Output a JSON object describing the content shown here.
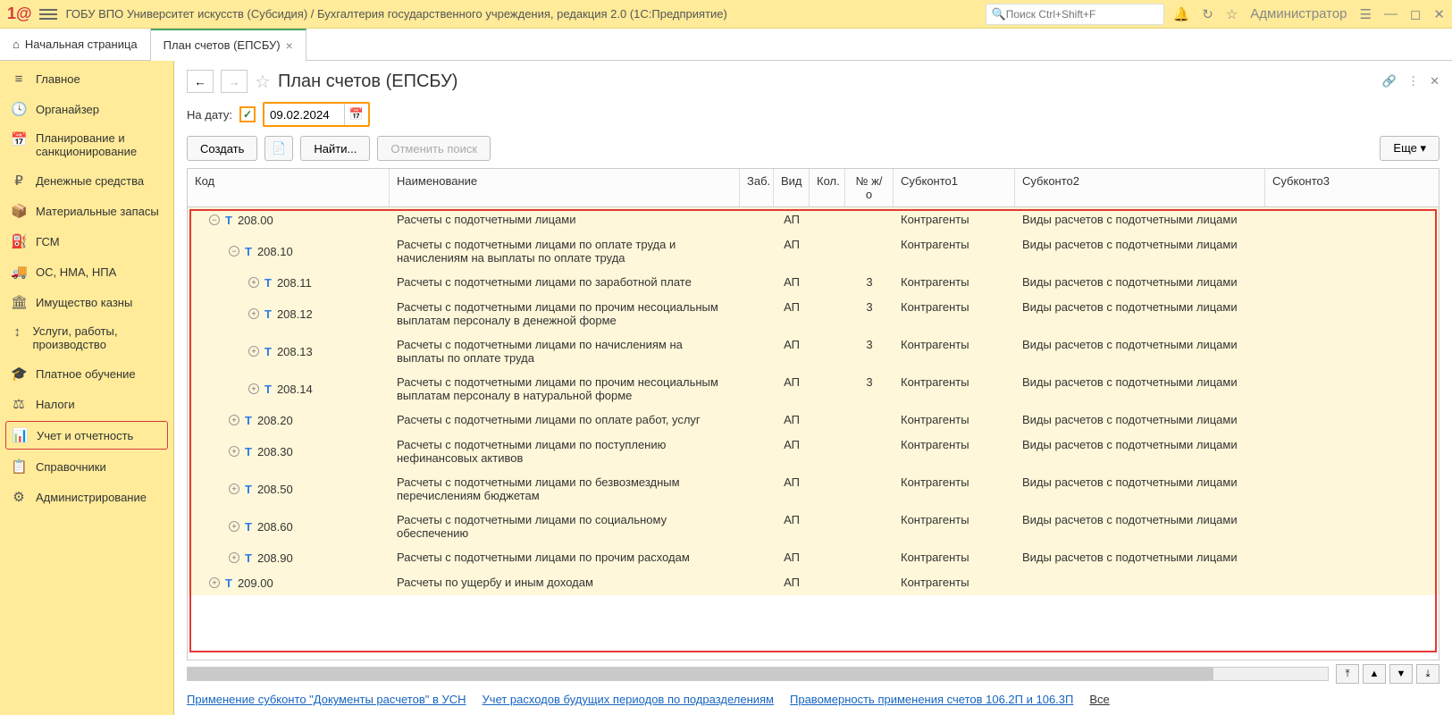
{
  "header": {
    "logo": "1@",
    "title": "ГОБУ ВПО Университет искусств (Субсидия) / Бухгалтерия государственного учреждения, редакция 2.0  (1С:Предприятие)",
    "search_placeholder": "Поиск Ctrl+Shift+F",
    "user": "Администратор"
  },
  "tabs": [
    {
      "label": "Начальная страница",
      "icon": "⌂"
    },
    {
      "label": "План счетов (ЕПСБУ)",
      "closable": true
    }
  ],
  "sidebar": [
    {
      "icon": "≡",
      "label": "Главное"
    },
    {
      "icon": "🕓",
      "label": "Органайзер"
    },
    {
      "icon": "📅",
      "label": "Планирование и санкционирование"
    },
    {
      "icon": "₽",
      "label": "Денежные средства"
    },
    {
      "icon": "📦",
      "label": "Материальные запасы"
    },
    {
      "icon": "⛽",
      "label": "ГСМ"
    },
    {
      "icon": "🚚",
      "label": "ОС, НМА, НПА"
    },
    {
      "icon": "🏛",
      "label": "Имущество казны"
    },
    {
      "icon": "↕",
      "label": "Услуги, работы, производство"
    },
    {
      "icon": "🎓",
      "label": "Платное обучение"
    },
    {
      "icon": "⚖",
      "label": "Налоги"
    },
    {
      "icon": "📊",
      "label": "Учет и отчетность",
      "selected": true
    },
    {
      "icon": "📋",
      "label": "Справочники"
    },
    {
      "icon": "⚙",
      "label": "Администрирование"
    }
  ],
  "page": {
    "title": "План счетов (ЕПСБУ)",
    "date_label": "На дату:",
    "date_value": "09.02.2024",
    "btn_create": "Создать",
    "btn_find": "Найти...",
    "btn_cancel": "Отменить поиск",
    "btn_more": "Еще ▾",
    "checkmark": "✓"
  },
  "grid": {
    "cols": {
      "code": "Код",
      "name": "Наименование",
      "zab": "Заб.",
      "vid": "Вид",
      "kol": "Кол.",
      "jo": "№ ж/о",
      "sub1": "Субконто1",
      "sub2": "Субконто2",
      "sub3": "Субконто3"
    },
    "rows": [
      {
        "lvl": 1,
        "exp": "−",
        "code": "208.00",
        "name": "Расчеты с подотчетными лицами",
        "vid": "АП",
        "jo": "",
        "sub1": "Контрагенты",
        "sub2": "Виды расчетов с подотчетными лицами"
      },
      {
        "lvl": 2,
        "exp": "−",
        "code": "208.10",
        "name": "Расчеты с подотчетными лицами по оплате труда и начислениям на выплаты по оплате труда",
        "vid": "АП",
        "jo": "",
        "sub1": "Контрагенты",
        "sub2": "Виды расчетов с подотчетными лицами"
      },
      {
        "lvl": 3,
        "exp": "+",
        "code": "208.11",
        "name": "Расчеты с подотчетными лицами по заработной плате",
        "vid": "АП",
        "jo": "3",
        "sub1": "Контрагенты",
        "sub2": "Виды расчетов с подотчетными лицами"
      },
      {
        "lvl": 3,
        "exp": "+",
        "code": "208.12",
        "name": "Расчеты с подотчетными лицами по прочим несоциальным выплатам персоналу в денежной форме",
        "vid": "АП",
        "jo": "3",
        "sub1": "Контрагенты",
        "sub2": "Виды расчетов с подотчетными лицами"
      },
      {
        "lvl": 3,
        "exp": "+",
        "code": "208.13",
        "name": "Расчеты с подотчетными лицами по начислениям на выплаты по оплате труда",
        "vid": "АП",
        "jo": "3",
        "sub1": "Контрагенты",
        "sub2": "Виды расчетов с подотчетными лицами"
      },
      {
        "lvl": 3,
        "exp": "+",
        "code": "208.14",
        "name": "Расчеты с подотчетными лицами по прочим несоциальным выплатам персоналу в натуральной форме",
        "vid": "АП",
        "jo": "3",
        "sub1": "Контрагенты",
        "sub2": "Виды расчетов с подотчетными лицами"
      },
      {
        "lvl": 2,
        "exp": "+",
        "code": "208.20",
        "name": "Расчеты с подотчетными лицами по оплате работ, услуг",
        "vid": "АП",
        "jo": "",
        "sub1": "Контрагенты",
        "sub2": "Виды расчетов с подотчетными лицами"
      },
      {
        "lvl": 2,
        "exp": "+",
        "code": "208.30",
        "name": "Расчеты с подотчетными лицами по поступлению нефинансовых активов",
        "vid": "АП",
        "jo": "",
        "sub1": "Контрагенты",
        "sub2": "Виды расчетов с подотчетными лицами"
      },
      {
        "lvl": 2,
        "exp": "+",
        "code": "208.50",
        "name": "Расчеты с подотчетными лицами по безвозмездным перечислениям бюджетам",
        "vid": "АП",
        "jo": "",
        "sub1": "Контрагенты",
        "sub2": "Виды расчетов с подотчетными лицами"
      },
      {
        "lvl": 2,
        "exp": "+",
        "code": "208.60",
        "name": "Расчеты с подотчетными лицами по социальному обеспечению",
        "vid": "АП",
        "jo": "",
        "sub1": "Контрагенты",
        "sub2": "Виды расчетов с подотчетными лицами"
      },
      {
        "lvl": 2,
        "exp": "+",
        "code": "208.90",
        "name": "Расчеты с подотчетными лицами по прочим расходам",
        "vid": "АП",
        "jo": "",
        "sub1": "Контрагенты",
        "sub2": "Виды расчетов с подотчетными лицами"
      },
      {
        "lvl": 1,
        "exp": "+",
        "code": "209.00",
        "name": "Расчеты по ущербу и иным доходам",
        "vid": "АП",
        "jo": "",
        "sub1": "Контрагенты",
        "sub2": ""
      }
    ]
  },
  "footer": {
    "link1": "Применение субконто \"Документы расчетов\" в УСН",
    "link2": "Учет расходов будущих периодов по подразделениям",
    "link3": "Правомерность применения счетов 106.2П и 106.3П",
    "all": "Все"
  }
}
